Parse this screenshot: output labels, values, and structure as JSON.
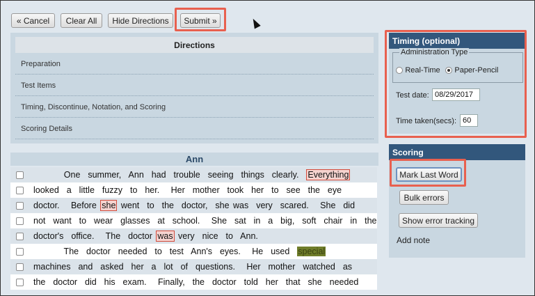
{
  "toolbar": {
    "cancel": "« Cancel",
    "clear_all": "Clear All",
    "hide_directions": "Hide Directions",
    "submit": "Submit »"
  },
  "directions": {
    "title": "Directions",
    "items": [
      "Preparation",
      "Test Items",
      "Timing, Discontinue, Notation, and Scoring",
      "Scoring Details"
    ]
  },
  "story": {
    "title": "Ann",
    "lines": [
      {
        "pre": "        One  summer,  Ann  had  trouble  seeing  things  clearly.  ",
        "mark": "Everything",
        "mark_type": "error",
        "post": ""
      },
      {
        "pre": "looked  a  little  fuzzy  to  her.   Her  mother  took  her  to  see  the  eye",
        "mark": "",
        "mark_type": "",
        "post": ""
      },
      {
        "pre": "doctor.   Before ",
        "mark": "she",
        "mark_type": "error",
        "post": " went  to  the  doctor,  she was  very  scared.   She  did"
      },
      {
        "pre": "not  want  to  wear  glasses  at  school.   She  sat  in  a  big,  soft  chair  in  the",
        "mark": "",
        "mark_type": "",
        "post": ""
      },
      {
        "pre": "doctor's  office.   The  doctor ",
        "mark": "was",
        "mark_type": "error",
        "post": " very  nice  to  Ann."
      },
      {
        "pre": "        The  doctor  needed  to  test  Ann's  eyes.   He  used  ",
        "mark": "special",
        "mark_type": "highlight",
        "post": ""
      },
      {
        "pre": "machines  and  asked  her  a  lot  of  questions.   Her  mother  watched  as",
        "mark": "",
        "mark_type": "",
        "post": ""
      },
      {
        "pre": "the  doctor  did  his  exam.   Finally,  the  doctor  told  her  that  she  needed",
        "mark": "",
        "mark_type": "",
        "post": ""
      }
    ]
  },
  "timing": {
    "title": "Timing (optional)",
    "admin_type_label": "Administration Type",
    "option_realtime": "Real-Time",
    "option_paper": "Paper-Pencil",
    "selected": "Paper-Pencil",
    "test_date_label": "Test date:",
    "test_date_value": "08/29/2017",
    "time_taken_label": "Time taken(secs):",
    "time_taken_value": "60"
  },
  "scoring": {
    "title": "Scoring",
    "mark_last_word": "Mark Last Word",
    "bulk_errors": "Bulk errors",
    "show_error_tracking": "Show error tracking",
    "add_note": "Add note"
  },
  "colors": {
    "highlight_box": "#e8604f",
    "panel_header": "#32577c",
    "panel_bg": "#c9d7e1",
    "error_word_bg": "#f5d3cf",
    "highlight_word_bg": "#6f7d2a"
  }
}
